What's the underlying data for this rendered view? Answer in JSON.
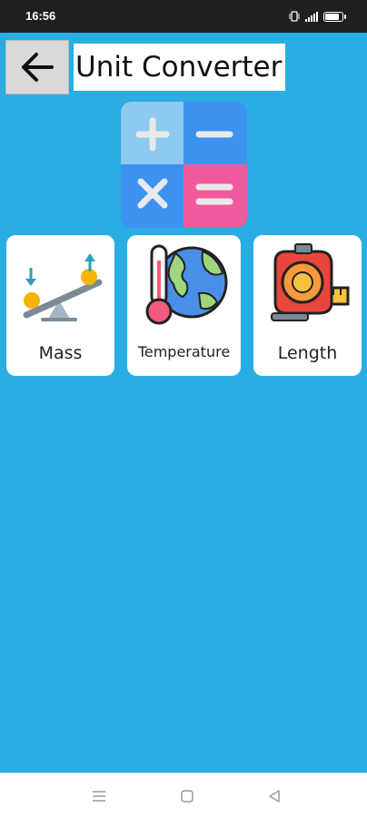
{
  "status_bar": {
    "time": "16:56",
    "icons": [
      "vibrate-icon",
      "signal-icon",
      "battery-icon"
    ],
    "battery_level": 0.75
  },
  "header": {
    "back_icon": "arrow-left-icon",
    "title": "Unit Converter"
  },
  "logo": {
    "symbols": [
      "plus",
      "minus",
      "multiply",
      "equals"
    ],
    "colors": [
      "#8EC9EF",
      "#3D92F0",
      "#3D92F0",
      "#F15B9D"
    ]
  },
  "categories": [
    {
      "label": "Mass",
      "icon": "seesaw-icon"
    },
    {
      "label": "Temperature",
      "icon": "thermometer-globe-icon"
    },
    {
      "label": "Length",
      "icon": "tape-measure-icon"
    }
  ],
  "nav_bar": {
    "icons": [
      "menu-icon",
      "home-icon",
      "back-icon"
    ]
  },
  "colors": {
    "background": "#29ADE3",
    "status_bar": "#1F1F1F",
    "card": "#FFFFFF",
    "back_button": "#D9D9D9"
  }
}
